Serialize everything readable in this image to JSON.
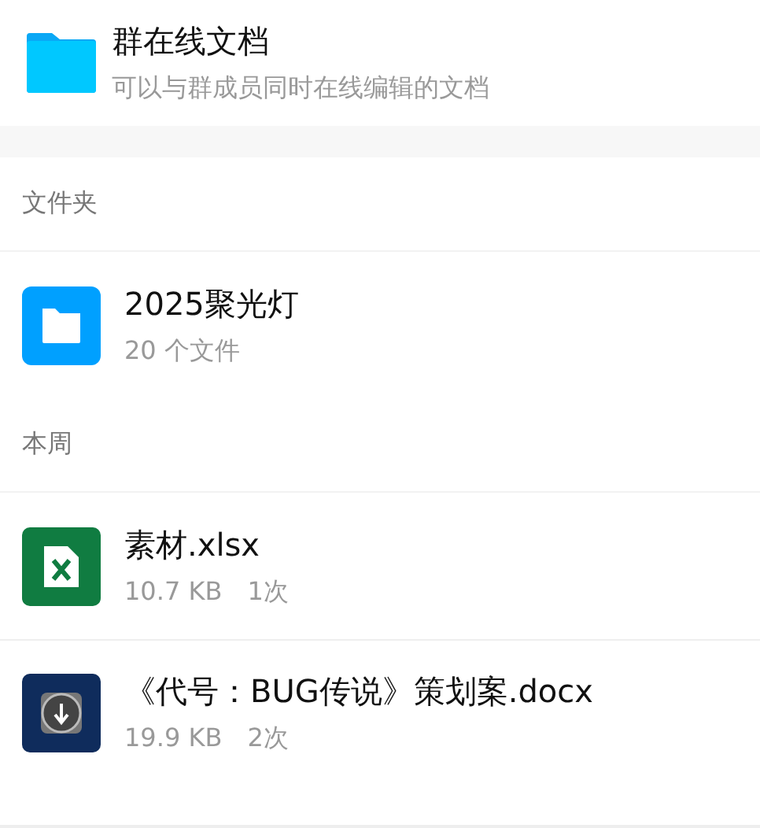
{
  "header": {
    "title": "群在线文档",
    "subtitle": "可以与群成员同时在线编辑的文档"
  },
  "sections": [
    {
      "title": "文件夹",
      "items": [
        {
          "kind": "folder",
          "name": "2025聚光灯",
          "meta": [
            "20 个文件"
          ]
        }
      ]
    },
    {
      "title": "本周",
      "items": [
        {
          "kind": "xlsx",
          "name": "素材.xlsx",
          "meta": [
            "10.7 KB",
            "1次"
          ]
        },
        {
          "kind": "docx",
          "name": "《代号：BUG传说》策划案.docx",
          "meta": [
            "19.9 KB",
            "2次"
          ]
        }
      ]
    }
  ]
}
